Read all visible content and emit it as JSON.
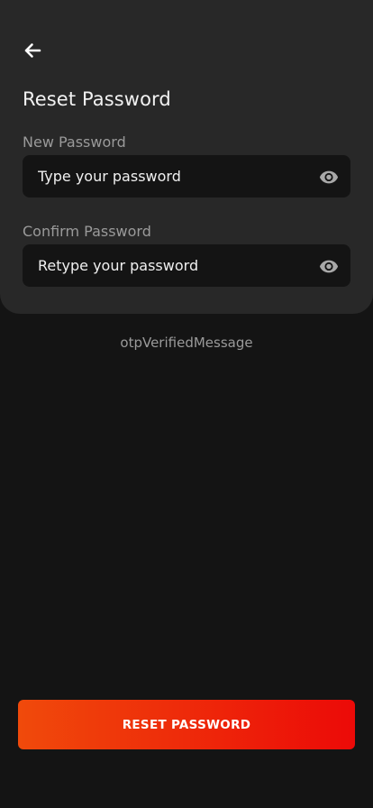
{
  "header": {
    "title": "Reset Password",
    "back_icon": "arrow-left-icon"
  },
  "new_password": {
    "label": "New Password",
    "placeholder": "Type your password",
    "value": "",
    "icon": "eye-icon"
  },
  "confirm_password": {
    "label": "Confirm Password",
    "placeholder": "Retype your password",
    "value": "",
    "icon": "eye-icon"
  },
  "otp_message": "otpVerifiedMessage",
  "reset_button": {
    "label": "RESET PASSWORD"
  },
  "colors": {
    "background": "#141414",
    "card": "#282828",
    "field_bg": "#141414",
    "accent_start": "#f04a0b",
    "accent_end": "#ec0a08",
    "muted_text": "#9a9a9a",
    "text": "#f0f0f0"
  }
}
